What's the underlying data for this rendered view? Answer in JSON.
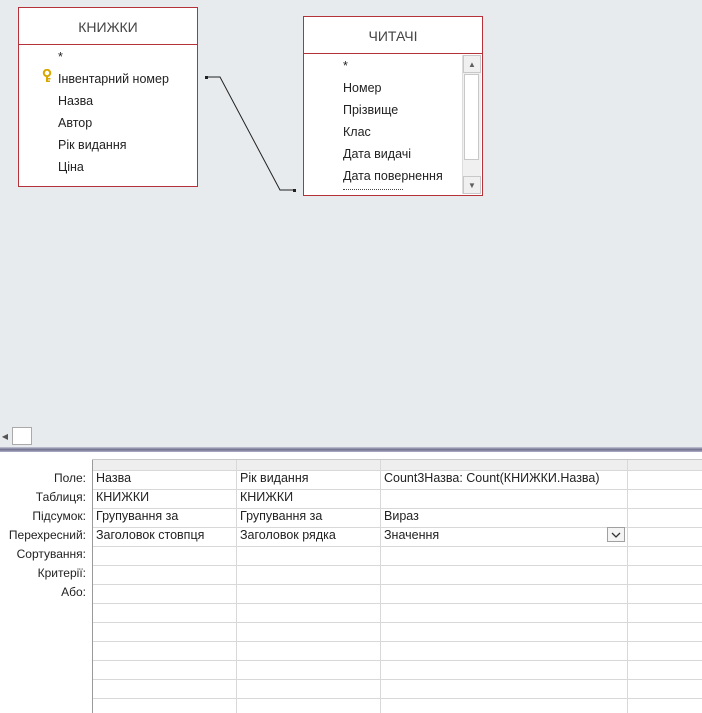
{
  "tables": [
    {
      "title": "КНИЖКИ",
      "fields": [
        {
          "label": "*",
          "primary_key": false
        },
        {
          "label": "Інвентарний номер",
          "primary_key": true
        },
        {
          "label": "Назва",
          "primary_key": false
        },
        {
          "label": "Автор",
          "primary_key": false
        },
        {
          "label": "Рік видання",
          "primary_key": false
        },
        {
          "label": "Ціна",
          "primary_key": false
        }
      ]
    },
    {
      "title": "ЧИТАЧІ",
      "fields": [
        {
          "label": "*"
        },
        {
          "label": "Номер"
        },
        {
          "label": "Прізвище"
        },
        {
          "label": "Клас"
        },
        {
          "label": "Дата видачі"
        },
        {
          "label": "Дата повернення"
        }
      ]
    }
  ],
  "grid": {
    "row_labels": [
      "Поле:",
      "Таблиця:",
      "Підсумок:",
      "Перехресний:",
      "Сортування:",
      "Критерії:",
      "Або:"
    ],
    "columns": [
      {
        "field": "Назва",
        "table": "КНИЖКИ",
        "total": "Групування за",
        "crosstab": "Заголовок стовпця"
      },
      {
        "field": "Рік видання",
        "table": "КНИЖКИ",
        "total": "Групування за",
        "crosstab": "Заголовок рядка"
      },
      {
        "field": "Count3Назва: Count(КНИЖКИ.Назва)",
        "table": "",
        "total": "Вираз",
        "crosstab": "Значення"
      }
    ]
  },
  "colors": {
    "table_border": "#b5323b",
    "design_background": "#e8ebee",
    "key_icon": "#d8a800"
  }
}
